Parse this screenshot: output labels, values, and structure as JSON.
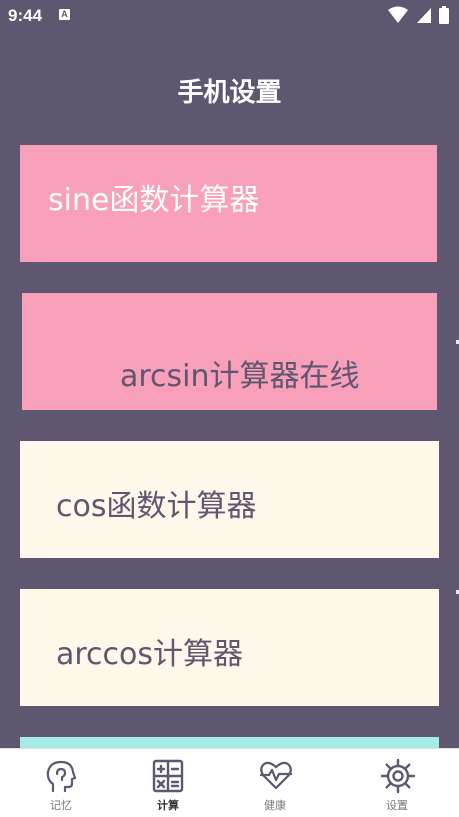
{
  "status_bar": {
    "time": "9:44",
    "notification_icon": "keyboard-a-icon",
    "icons": [
      "wifi-icon",
      "signal-icon",
      "battery-icon"
    ]
  },
  "page": {
    "title": "手机设置"
  },
  "cards": [
    {
      "label": "sine函数计算器",
      "color": "#f89fb9"
    },
    {
      "label": "arcsin计算器在线",
      "color": "#f89fb9"
    },
    {
      "label": "cos函数计算器",
      "color": "#fdf8ea"
    },
    {
      "label": "arccos计算器",
      "color": "#fdf8ea"
    }
  ],
  "next_card_color": "#a5ebe6",
  "bottom_nav": {
    "items": [
      {
        "label": "记忆",
        "icon": "head-brain-icon",
        "active": false
      },
      {
        "label": "计算",
        "icon": "calculator-icon",
        "active": true
      },
      {
        "label": "健康",
        "icon": "heart-pulse-icon",
        "active": false
      },
      {
        "label": "设置",
        "icon": "gear-icon",
        "active": false
      }
    ]
  },
  "colors": {
    "background": "#5f5670",
    "pink": "#f89fb9",
    "cream": "#fdf8ea",
    "teal": "#a5ebe6",
    "nav_bg": "#ffffff"
  }
}
